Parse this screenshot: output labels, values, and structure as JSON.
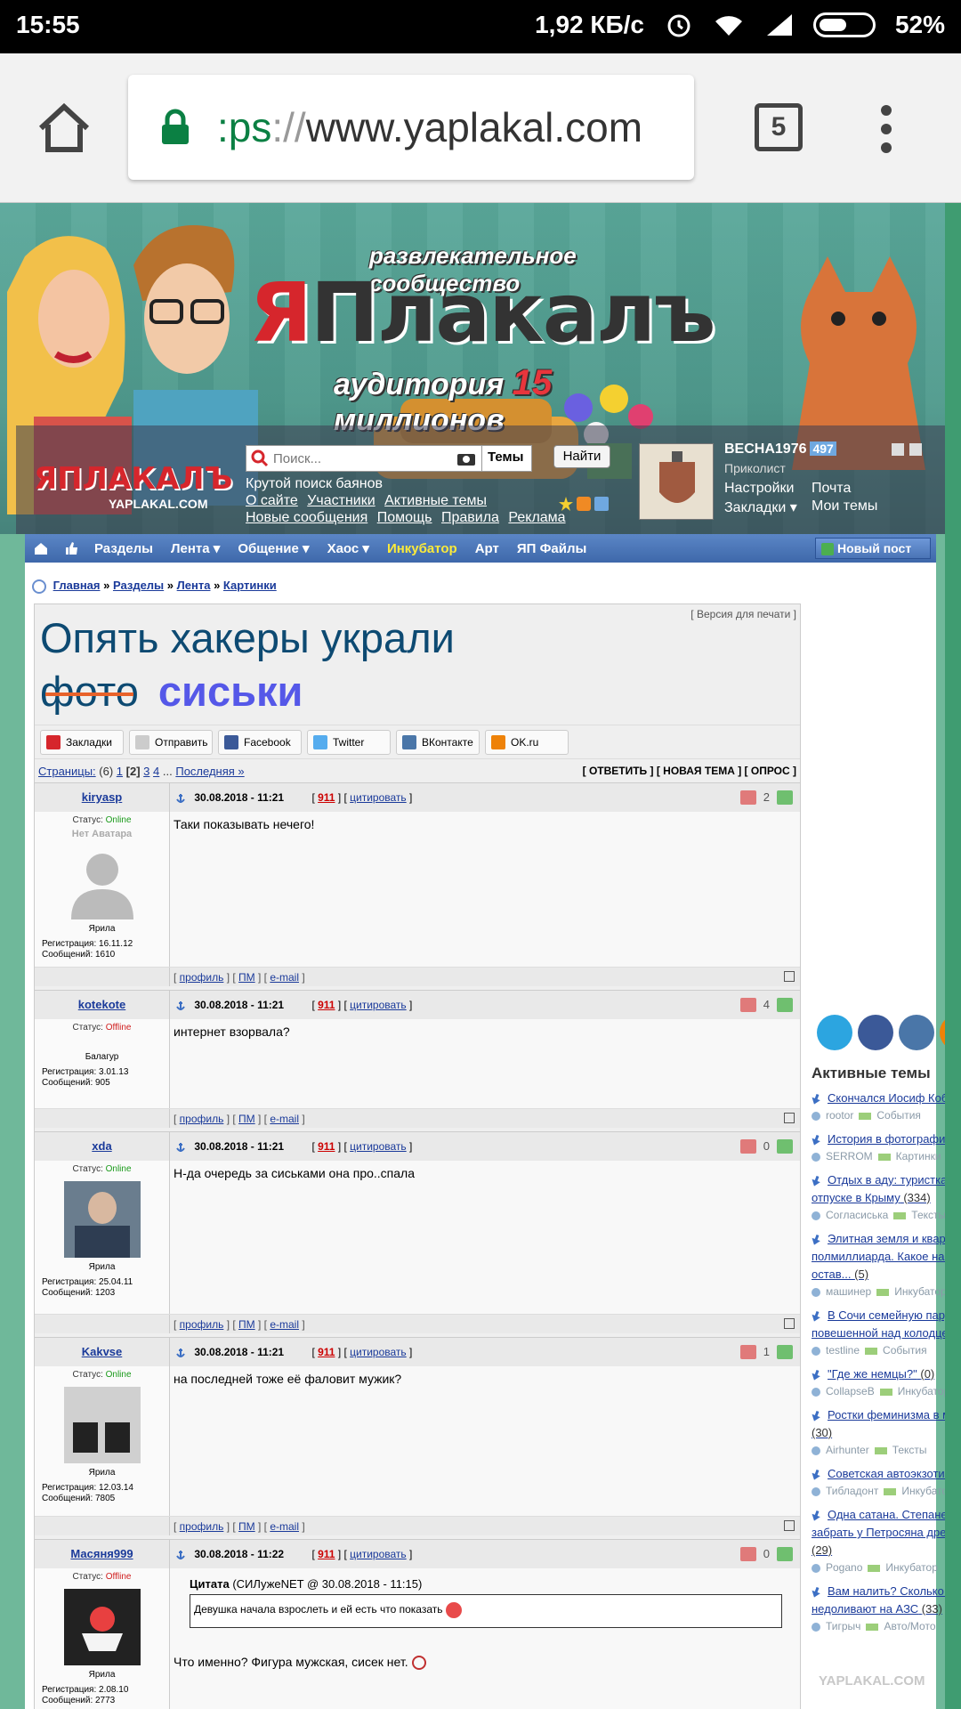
{
  "status_bar": {
    "time": "15:55",
    "speed": "1,92 КБ/с",
    "battery": "52%"
  },
  "browser": {
    "url_scheme": ":ps",
    "url_sep": "://",
    "url_host": "www.yaplakal.com",
    "tab_count": "5"
  },
  "banner": {
    "tagline_top": "развлекательное сообщество",
    "logo_main_red": "Я",
    "logo_main_rest": "Плакалъ",
    "tagline_bottom_a": "аудитория",
    "tagline_bottom_num": "15",
    "tagline_bottom_b": "миллионов",
    "small_logo": "ЯПЛАКАЛЪ",
    "small_logo_url": "YAPLAKAL.COM"
  },
  "header": {
    "search_placeholder": "Поиск...",
    "search_scope": "Темы",
    "find_button": "Найти",
    "tagline": "Крутой поиск баянов",
    "links_row1": [
      "О сайте",
      "Участники",
      "Активные темы"
    ],
    "links_row2": [
      "Новые сообщения",
      "Помощь",
      "Правила",
      "Реклама"
    ]
  },
  "user": {
    "name": "ВЕСНА1976",
    "count": "497",
    "rank": "Приколист",
    "menu": [
      "Настройки",
      "Почта",
      "Закладки ▾",
      "Мои темы"
    ]
  },
  "nav": {
    "items": [
      "Разделы",
      "Лента ▾",
      "Общение ▾",
      "Хаос ▾",
      "Инкубатор",
      "Арт",
      "ЯП Файлы"
    ],
    "highlight_index": 4,
    "new_post": "Новый пост"
  },
  "breadcrumbs": [
    "Главная",
    "Разделы",
    "Лента",
    "Картинки"
  ],
  "topic": {
    "print_version": "[ Версия для печати ]",
    "title_line1": "Опять хакеры украли",
    "title_strike": "фото",
    "title_big": "сиськи",
    "share": [
      "Закладки",
      "Отправить",
      "Facebook",
      "Twitter",
      "ВКонтакте",
      "OK.ru"
    ],
    "pages_label": "Страницы:",
    "pages_count": "(6)",
    "pages": [
      "1",
      "[2]",
      "3",
      "4",
      "...",
      "Последняя »"
    ],
    "actions": "[ ОТВЕТИТЬ ] [ НОВАЯ ТЕМА ] [ ОПРОС ]"
  },
  "post_links": {
    "profile": "профиль",
    "pm": "ПМ",
    "email": "e-mail",
    "cite": "цитировать",
    "n911": "911"
  },
  "posts": [
    {
      "nick": "kiryasp",
      "date": "30.08.2018 - 11:21",
      "rating": "2",
      "status_label": "Статус:",
      "status": "Online",
      "avatar_caption": "Нет Аватара",
      "rank": "Ярила",
      "reg": "Регистрация: 16.11.12",
      "msgs": "Сообщений: 1610",
      "text": "Таки показывать нечего!"
    },
    {
      "nick": "kotekote",
      "date": "30.08.2018 - 11:21",
      "rating": "4",
      "status_label": "Статус:",
      "status": "Offline",
      "rank": "Балагур",
      "reg": "Регистрация: 3.01.13",
      "msgs": "Сообщений: 905",
      "text": "интернет взорвала?"
    },
    {
      "nick": "xda",
      "date": "30.08.2018 - 11:21",
      "rating": "0",
      "status_label": "Статус:",
      "status": "Online",
      "rank": "Ярила",
      "reg": "Регистрация: 25.04.11",
      "msgs": "Сообщений: 1203",
      "text": "Н-да очередь за сиськами она про..спала"
    },
    {
      "nick": "Kakvse",
      "date": "30.08.2018 - 11:21",
      "rating": "1",
      "status_label": "Статус:",
      "status": "Online",
      "rank": "Ярила",
      "reg": "Регистрация: 12.03.14",
      "msgs": "Сообщений: 7805",
      "text": "на последней тоже её фаловит мужик?"
    },
    {
      "nick": "Масяня999",
      "date": "30.08.2018 - 11:22",
      "rating": "0",
      "status_label": "Статус:",
      "status": "Offline",
      "rank": "Ярила",
      "reg": "Регистрация: 2.08.10",
      "msgs": "Сообщений: 2773",
      "quote_label": "Цитата",
      "quote_src": "(СИЛужеNET @ 30.08.2018 - 11:15)",
      "quote_text": "Девушка начала взрослеть и ей есть что показать",
      "text": "Что именно? Фигура мужская, сисек нет."
    }
  ],
  "right": {
    "active_title": "Активные темы",
    "topics": [
      {
        "title": "Скончался Иосиф Кобзо",
        "user": "rootor",
        "section": "События"
      },
      {
        "title": "История в фотографиях",
        "user": "SERROM",
        "section": "Картинки"
      },
      {
        "title": "Отдых в аду: туристка и отпуске в Крыму",
        "count": "(334)",
        "user": "Согласиська",
        "section": "Тексты"
      },
      {
        "title": "Элитная земля и кварти полмиллиарда. Какое насл остав...",
        "count": "(5)",
        "user": "машинер",
        "section": "Инкубатор"
      },
      {
        "title": "В Сочи семейную пару с повешенной над колодцем",
        "user": "testline",
        "section": "События"
      },
      {
        "title": "\"Где же немцы?\"",
        "count": "(0)",
        "user": "CollapseB",
        "section": "Инкубатор"
      },
      {
        "title": "Ростки феминизма в мо",
        "count": "(30)",
        "user": "Airhunter",
        "section": "Тексты"
      },
      {
        "title": "Советская автоэкзотика",
        "user": "Тибладонт",
        "section": "Инкубатор"
      },
      {
        "title": "Одна сатана. Степанен забрать у Петросяна древн",
        "count": "(29)",
        "user": "Pogano",
        "section": "Инкубатор"
      },
      {
        "title": "Вам налить? Сколько на недоливают на АЗС",
        "count": "(33)",
        "user": "Тигрыч",
        "section": "Авто/Мото"
      }
    ],
    "watermark": "YAPLAKAL.COM"
  },
  "colors": {
    "accent_red": "#d6262c",
    "nav_blue": "#4a74b6",
    "title_blue": "#0d4a72",
    "big_word": "#5558e8",
    "online": "#1a9a1a",
    "offline": "#d02020"
  }
}
